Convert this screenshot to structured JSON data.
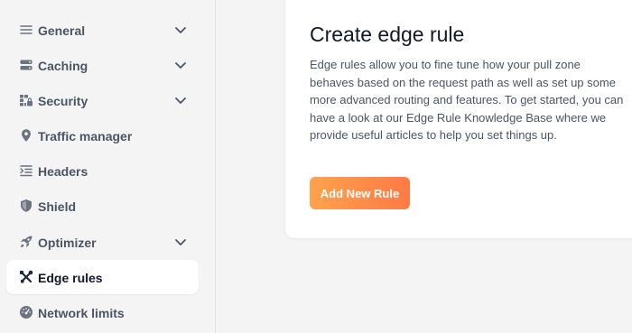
{
  "sidebar": {
    "items": [
      {
        "label": "General",
        "icon": "menu-lines-icon",
        "expandable": true,
        "active": false
      },
      {
        "label": "Caching",
        "icon": "server-icon",
        "expandable": true,
        "active": false
      },
      {
        "label": "Security",
        "icon": "lock-grid-icon",
        "expandable": true,
        "active": false
      },
      {
        "label": "Traffic manager",
        "icon": "map-pin-icon",
        "expandable": false,
        "active": false
      },
      {
        "label": "Headers",
        "icon": "indent-list-icon",
        "expandable": false,
        "active": false
      },
      {
        "label": "Shield",
        "icon": "shield-icon",
        "expandable": false,
        "active": false
      },
      {
        "label": "Optimizer",
        "icon": "rocket-icon",
        "expandable": true,
        "active": false
      },
      {
        "label": "Edge rules",
        "icon": "tools-icon",
        "expandable": false,
        "active": true
      },
      {
        "label": "Network limits",
        "icon": "gauge-icon",
        "expandable": false,
        "active": false
      }
    ]
  },
  "card": {
    "title": "Create edge rule",
    "description": "Edge rules allow you to fine tune how your pull zone behaves based on the request path as well as set up some more advanced routing and features. To get started, you can have a look at our Edge Rule Knowledge Base where we provide useful articles to help you set things up.",
    "button_label": "Add New Rule"
  },
  "colors": {
    "accent_start": "#ffa24d",
    "accent_end": "#ff7a45",
    "active_bg": "#ffffff",
    "sidebar_bg": "#f4f4f5"
  }
}
